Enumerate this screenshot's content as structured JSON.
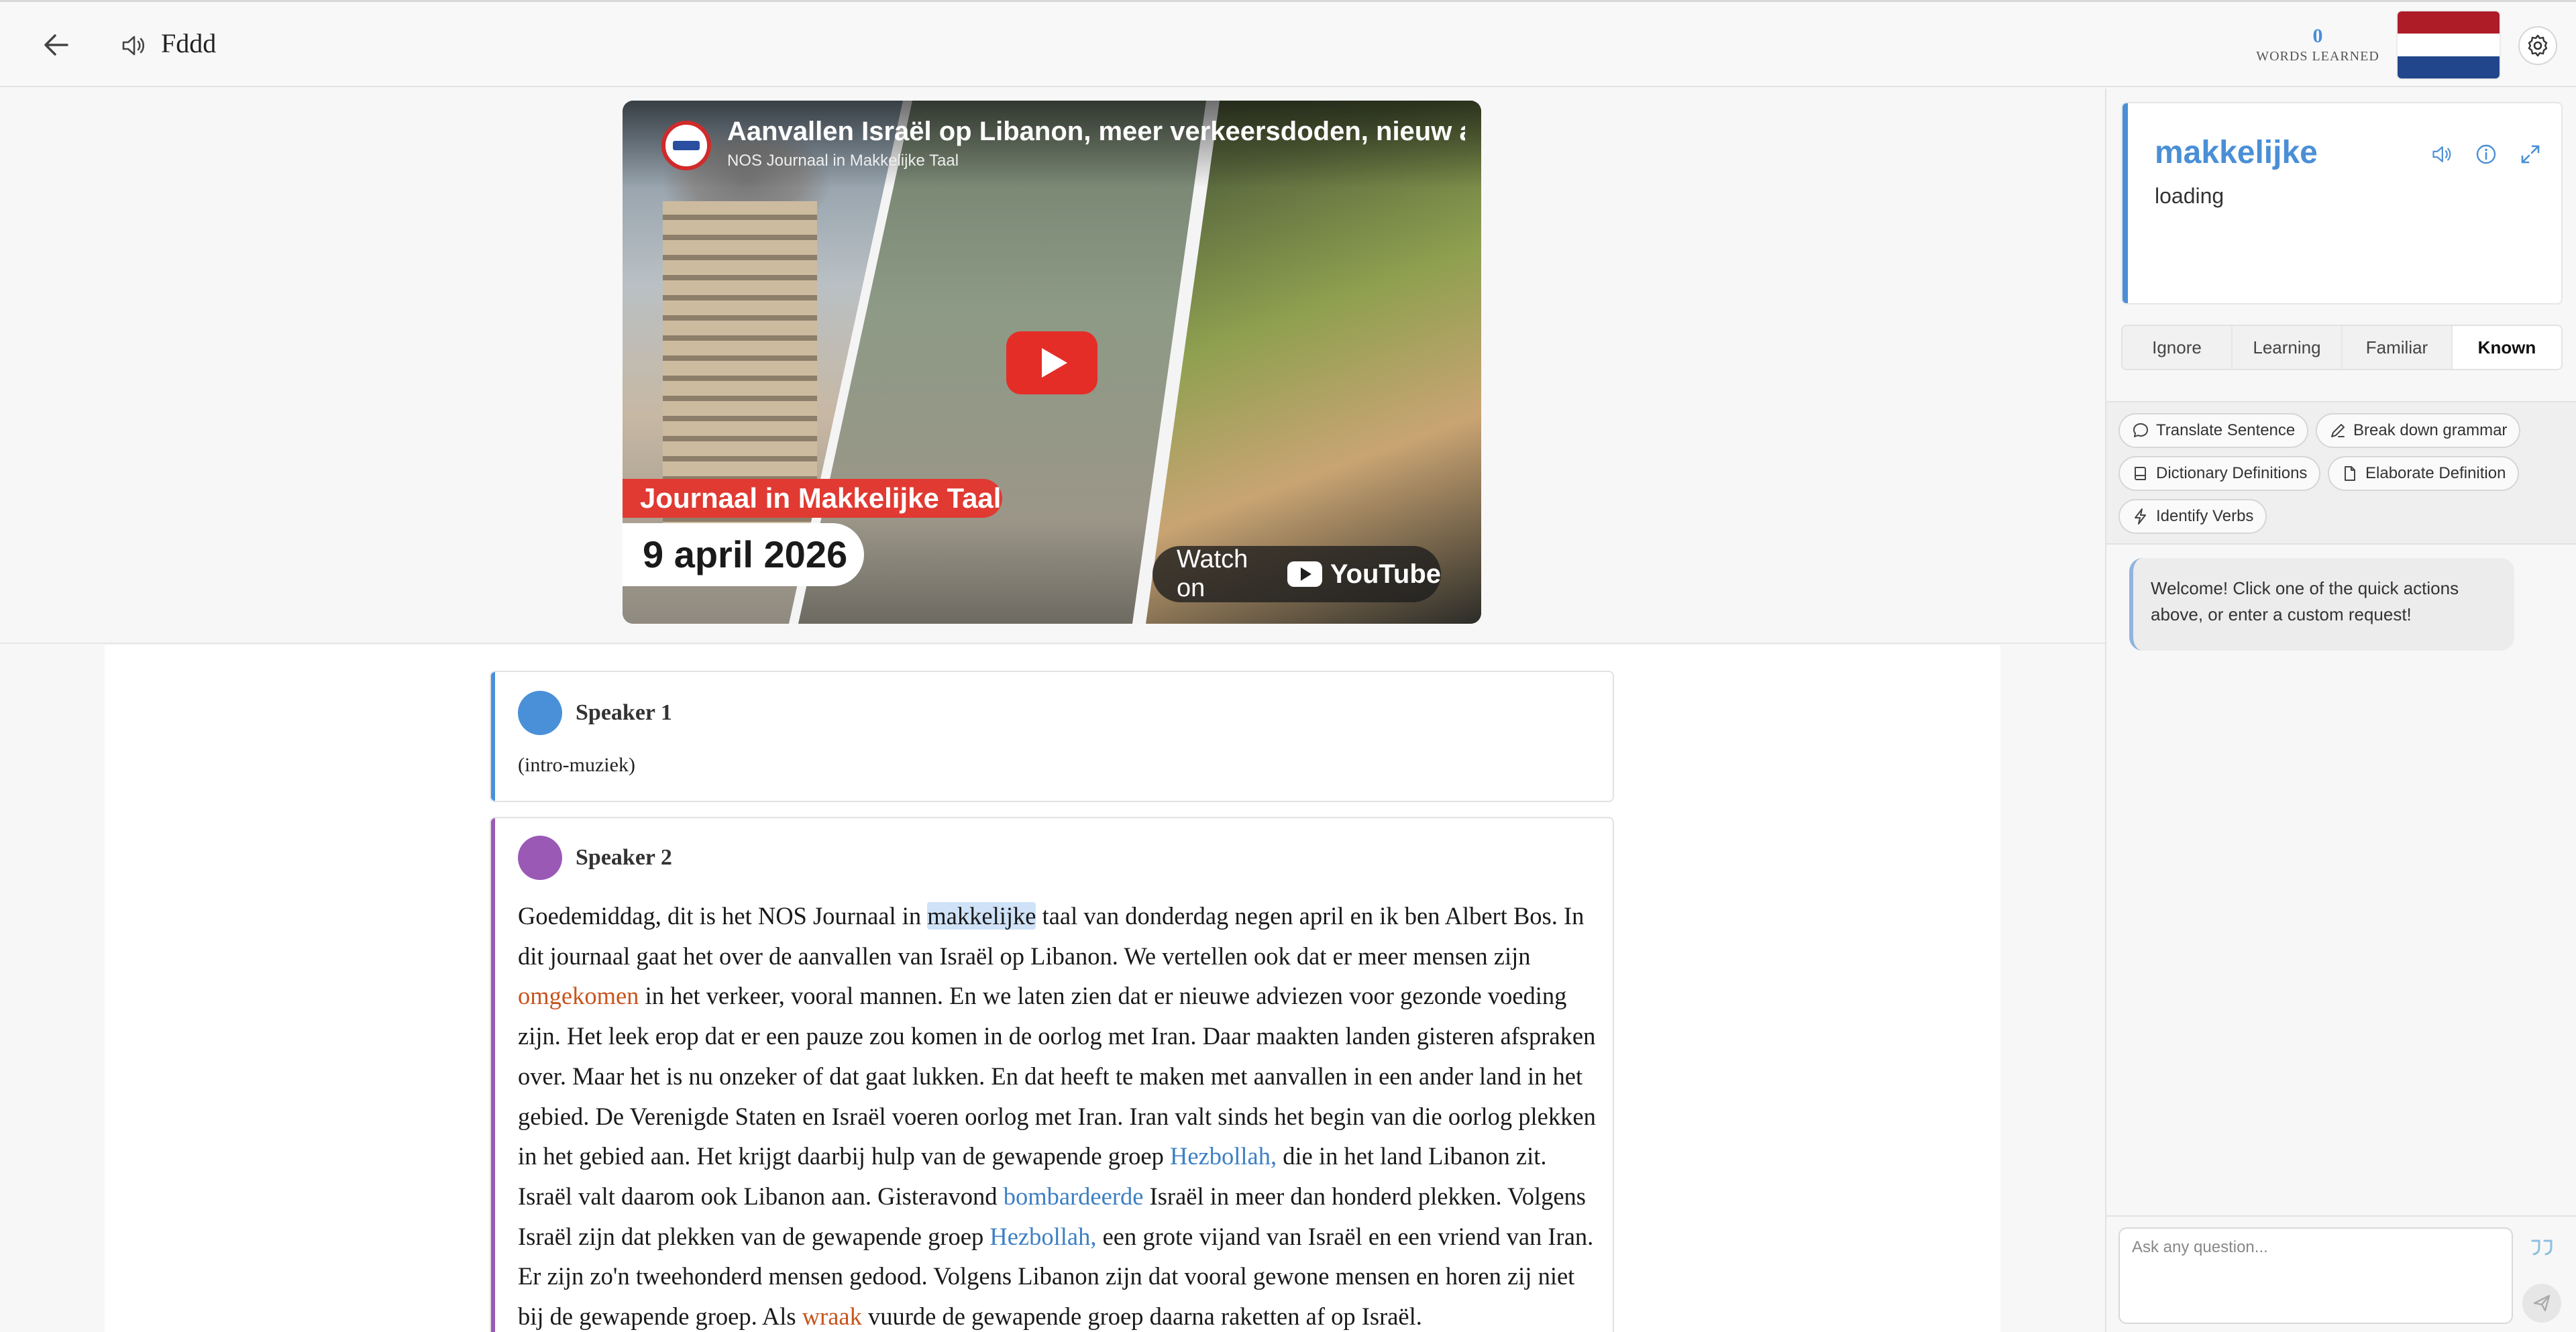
{
  "header": {
    "title": "Fddd",
    "words_learned_count": "0",
    "words_learned_label": "WORDS LEARNED",
    "flag_colors": [
      "#ae1c28",
      "#ffffff",
      "#21468b"
    ]
  },
  "video": {
    "title": "Aanvallen Israël op Libanon, meer verkeersdoden, nieuw advies",
    "channel": "NOS Journaal in Makkelijke Taal",
    "banner": "Journaal in Makkelijke Taal",
    "date": "9 april 2026",
    "watch_on": "Watch on",
    "youtube": "YouTube"
  },
  "transcript": {
    "speaker1": {
      "name": "Speaker 1",
      "color": "#4a90d9",
      "text": "(intro-muziek)"
    },
    "speaker2": {
      "name": "Speaker 2",
      "color": "#9b59b6",
      "segments": [
        {
          "text": "Goedemiddag, dit is het NOS Journaal in ",
          "status": "known"
        },
        {
          "text": "makkelijke",
          "status": "selected"
        },
        {
          "text": " taal van donderdag negen april en ik ben Albert Bos. In dit journaal gaat het over de aanvallen van Israël op Libanon. We vertellen ook dat er meer mensen zijn ",
          "status": "known"
        },
        {
          "text": "omgekomen",
          "status": "learning"
        },
        {
          "text": " in het verkeer, vooral mannen. En we laten zien dat er nieuwe adviezen voor gezonde voeding zijn. Het leek erop dat er een pauze zou komen in de oorlog met Iran. Daar maakten landen gisteren afspraken over. Maar het is nu onzeker of dat gaat lukken. En dat heeft te maken met aanvallen in een ander land in het gebied. De Verenigde Staten en Israël voeren oorlog met Iran. Iran valt sinds het begin van die oorlog plekken in het gebied aan. Het krijgt daarbij hulp van de gewapende groep ",
          "status": "known"
        },
        {
          "text": "Hezbollah,",
          "status": "new"
        },
        {
          "text": " die in het land Libanon zit. Israël valt daarom ook Libanon aan. Gisteravond ",
          "status": "known"
        },
        {
          "text": "bombardeerde",
          "status": "new"
        },
        {
          "text": " Israël in meer dan honderd plekken. Volgens Israël zijn dat plekken van de gewapende groep ",
          "status": "known"
        },
        {
          "text": "Hezbollah,",
          "status": "new"
        },
        {
          "text": " een grote vijand van Israël en een vriend van Iran. Er zijn zo'n tweehonderd mensen gedood. Volgens Libanon zijn dat vooral gewone mensen en horen zij niet bij de gewapende groep. Als ",
          "status": "known"
        },
        {
          "text": "wraak",
          "status": "learning"
        },
        {
          "text": " vuurde de gewapende groep daarna raketten af op Israël.",
          "status": "known"
        }
      ]
    }
  },
  "word_panel": {
    "word": "makkelijke",
    "definition": "loading",
    "status_options": [
      "Ignore",
      "Learning",
      "Familiar",
      "Known"
    ],
    "active_status": "Known"
  },
  "quick_actions": [
    {
      "label": "Translate Sentence",
      "icon": "chat-bubble-icon"
    },
    {
      "label": "Break down grammar",
      "icon": "pen-icon"
    },
    {
      "label": "Dictionary Definitions",
      "icon": "book-icon"
    },
    {
      "label": "Elaborate Definition",
      "icon": "document-icon"
    },
    {
      "label": "Identify Verbs",
      "icon": "lightning-icon"
    }
  ],
  "chat": {
    "welcome": "Welcome! Click one of the quick actions above, or enter a custom request!",
    "input_placeholder": "Ask any question..."
  }
}
